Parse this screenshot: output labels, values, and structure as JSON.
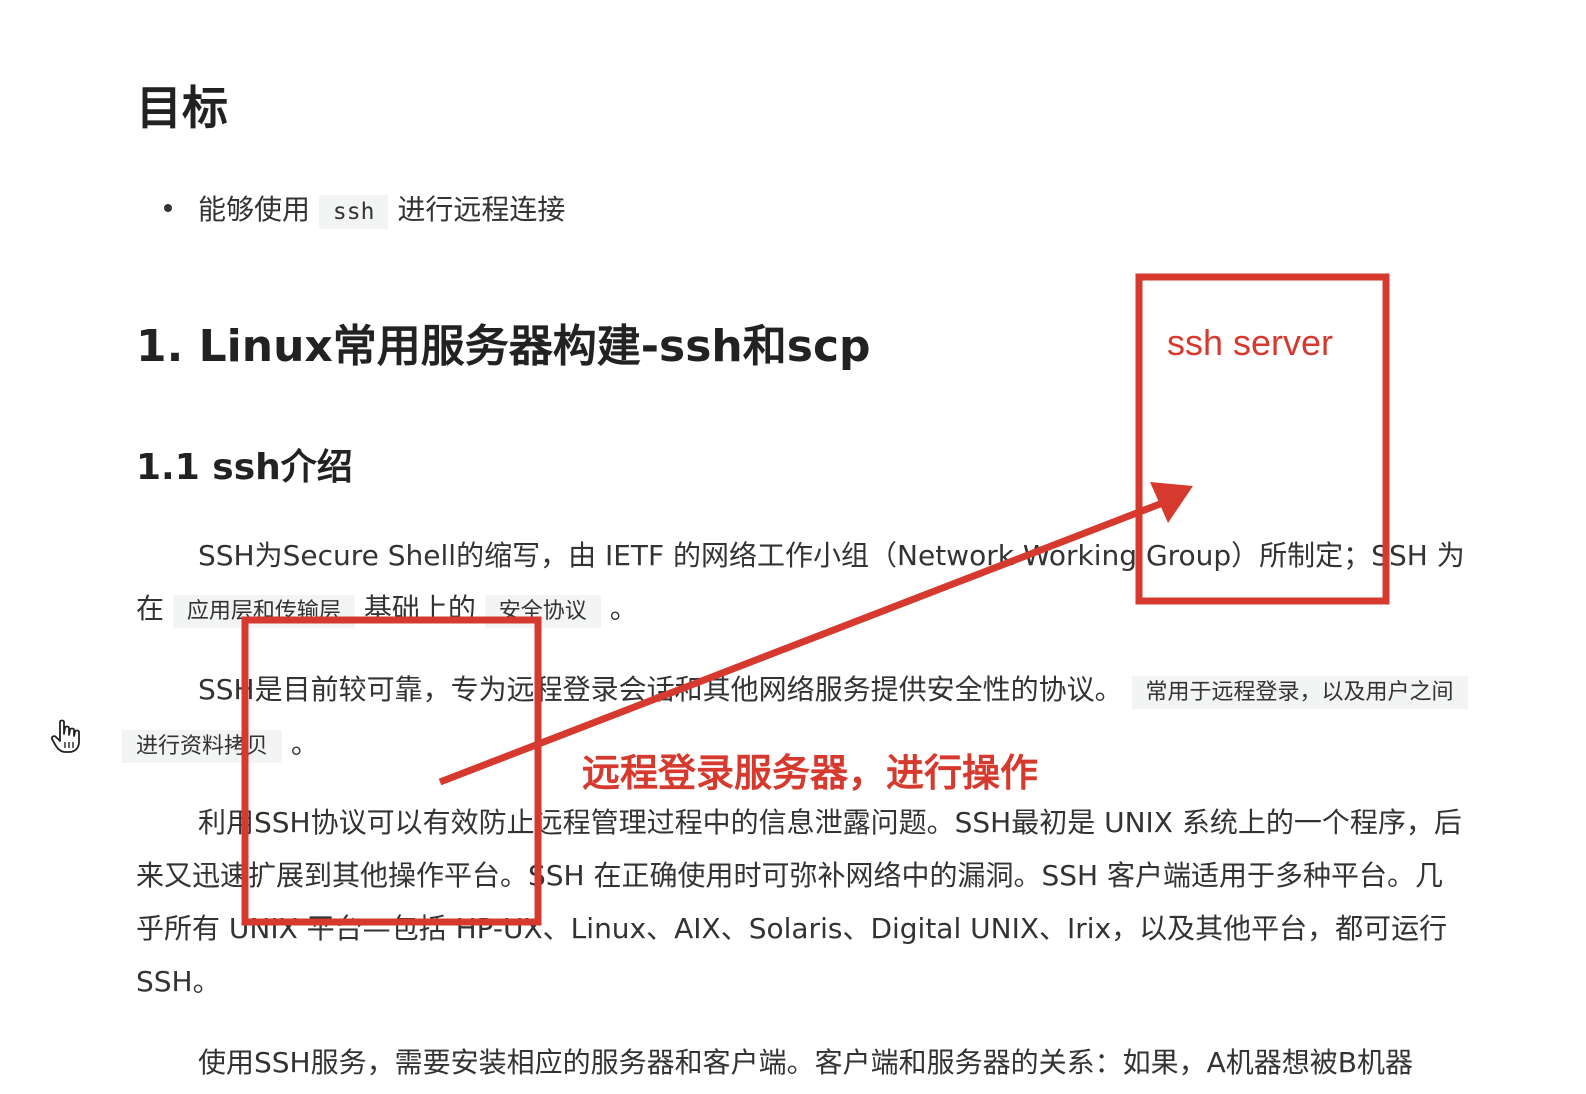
{
  "heading_goal": "目标",
  "goals": [
    {
      "before": "能够使用",
      "code": "ssh",
      "after": "进行远程连接"
    }
  ],
  "section_title": "1. Linux常用服务器构建-ssh和scp",
  "subsection_title": "1.1 ssh介绍",
  "paragraphs": {
    "p1_line1": "SSH为Secure Shell的缩写，由 IETF 的网络工作小组（Network Working Group）所制定；SSH 为",
    "p1_line2_a": "在",
    "p1_line2_chip1": "应用层和传输层",
    "p1_line2_b": "基础上的",
    "p1_line2_chip2": "安全协议",
    "p1_line2_c": "。",
    "p2_line1_a": "SSH是目前较可靠，专为远程登录会话和其他网络服务提供安全性的协议。",
    "p2_line1_chip": "常用于远程登录，以及用户之间",
    "p2_line2_chip": "进行资料拷贝",
    "p2_line2_c": "。",
    "p3_line1": "利用SSH协议可以有效防止远程管理过程中的信息泄露问题。SSH最初是 UNIX 系统上的一个程序，后",
    "p3_line2": "来又迅速扩展到其他操作平台。SSH 在正确使用时可弥补网络中的漏洞。SSH 客户端适用于多种平台。几",
    "p3_line3": "乎所有 UNIX 平台—包括 HP-UX、Linux、AIX、Solaris、Digital UNIX、Irix，以及其他平台，都可运行",
    "p3_line4": "SSH。",
    "p4_line1": "使用SSH服务，需要安装相应的服务器和客户端。客户端和服务器的关系：如果，A机器想被B机器"
  },
  "annotations": {
    "server_label": "ssh server",
    "action_label": "远程登录服务器，进行操作",
    "color": "#d63a2f"
  },
  "cursor_icon": "hand-pointer-icon"
}
